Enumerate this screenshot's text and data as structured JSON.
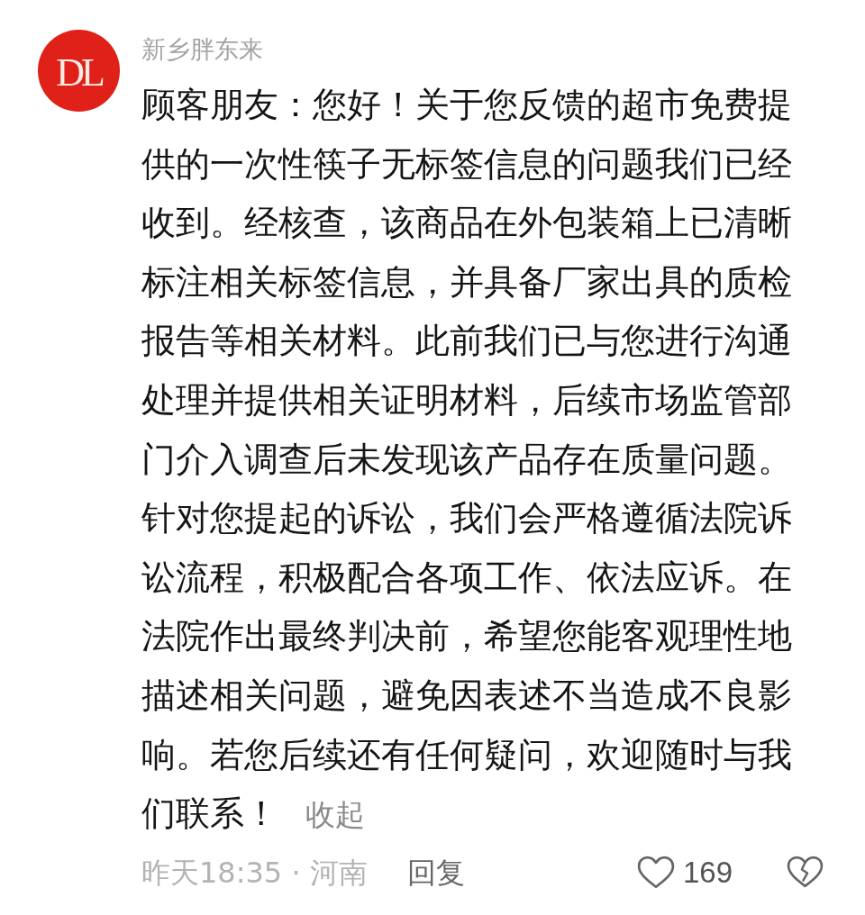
{
  "author": {
    "name": "新乡胖东来",
    "avatar_logo": "DL"
  },
  "comment": {
    "text": "顾客朋友：您好！关于您反馈的超市免费提供的一次性筷子无标签信息的问题我们已经收到。经核查，该商品在外包装箱上已清晰标注相关标签信息，并具备厂家出具的质检报告等相关材料。此前我们已与您进行沟通处理并提供相关证明材料，后续市场监管部门介入调查后未发现该产品存在质量问题。针对您提起的诉讼，我们会严格遵循法院诉讼流程，积极配合各项工作、依法应诉。在法院作出最终判决前，希望您能客观理性地描述相关问题，避免因表述不当造成不良影响。若您后续还有任何疑问，欢迎随时与我们联系！",
    "collapse_link": "收起"
  },
  "footer": {
    "meta": "昨天18:35 · 河南",
    "reply": "回复",
    "like_count": "169"
  }
}
